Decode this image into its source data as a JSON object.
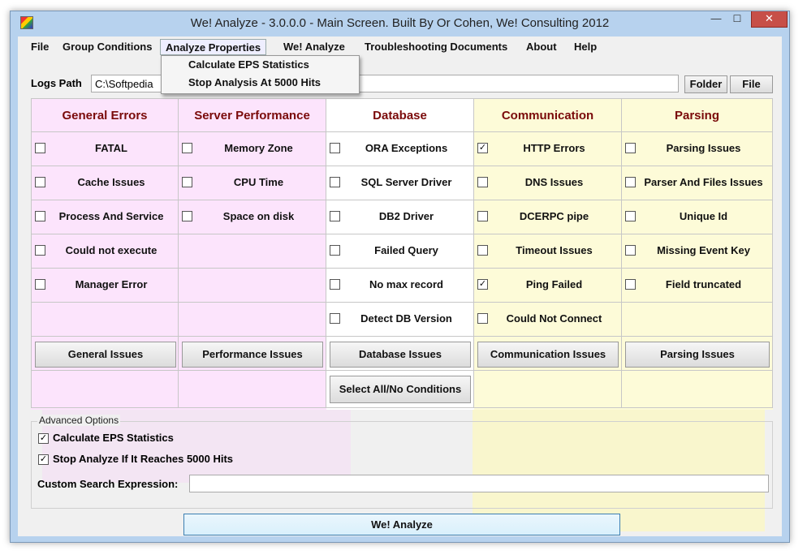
{
  "window": {
    "title": "We! Analyze - 3.0.0.0 - Main Screen. Built By Or Cohen, We! Consulting 2012",
    "min_glyph": "—",
    "max_glyph": "☐",
    "close_glyph": "✕"
  },
  "menu": {
    "items": [
      "File",
      "Group Conditions",
      "Analyze Properties",
      "We! Analyze",
      "Troubleshooting Documents",
      "About",
      "Help"
    ],
    "dropdown": [
      "Calculate EPS Statistics",
      "Stop Analysis At 5000 Hits"
    ]
  },
  "logs": {
    "label": "Logs Path",
    "value": "C:\\Softpedia",
    "folder_button": "Folder",
    "file_button": "File"
  },
  "columns": [
    {
      "header": "General Errors",
      "bg": "#fce4fc",
      "items": [
        {
          "label": "FATAL",
          "checked": false
        },
        {
          "label": "Cache Issues",
          "checked": false
        },
        {
          "label": "Process And Service",
          "checked": false
        },
        {
          "label": "Could not execute",
          "checked": false
        },
        {
          "label": "Manager Error",
          "checked": false
        }
      ],
      "button": "General Issues"
    },
    {
      "header": "Server Performance",
      "bg": "#fce4fc",
      "items": [
        {
          "label": "Memory Zone",
          "checked": false
        },
        {
          "label": "CPU Time",
          "checked": false
        },
        {
          "label": "Space on disk",
          "checked": false
        }
      ],
      "button": "Performance Issues"
    },
    {
      "header": "Database",
      "bg": "#fff",
      "items": [
        {
          "label": "ORA Exceptions",
          "checked": false
        },
        {
          "label": "SQL Server Driver",
          "checked": false
        },
        {
          "label": "DB2 Driver",
          "checked": false
        },
        {
          "label": "Failed Query",
          "checked": false
        },
        {
          "label": "No max record",
          "checked": false
        },
        {
          "label": "Detect DB Version",
          "checked": false
        }
      ],
      "button": "Database Issues",
      "extra_button": "Select All/No Conditions"
    },
    {
      "header": "Communication",
      "bg": "#fdfbd8",
      "items": [
        {
          "label": "HTTP Errors",
          "checked": true
        },
        {
          "label": "DNS Issues",
          "checked": false
        },
        {
          "label": "DCERPC pipe",
          "checked": false
        },
        {
          "label": "Timeout Issues",
          "checked": false
        },
        {
          "label": "Ping Failed",
          "checked": true
        },
        {
          "label": "Could Not Connect",
          "checked": false
        }
      ],
      "button": "Communication Issues"
    },
    {
      "header": "Parsing",
      "bg": "#fdfbd8",
      "items": [
        {
          "label": "Parsing Issues",
          "checked": false
        },
        {
          "label": "Parser And Files Issues",
          "checked": false
        },
        {
          "label": "Unique Id",
          "checked": false
        },
        {
          "label": "Missing Event Key",
          "checked": false
        },
        {
          "label": "Field truncated",
          "checked": false
        }
      ],
      "button": "Parsing Issues"
    }
  ],
  "advanced": {
    "legend": "Advanced Options",
    "opt1": {
      "label": "Calculate EPS Statistics",
      "checked": true
    },
    "opt2": {
      "label": "Stop Analyze If It Reaches 5000 Hits",
      "checked": true
    },
    "search_label": "Custom Search Expression:",
    "search_value": ""
  },
  "analyze_button": "We! Analyze",
  "check_glyph": "✓"
}
